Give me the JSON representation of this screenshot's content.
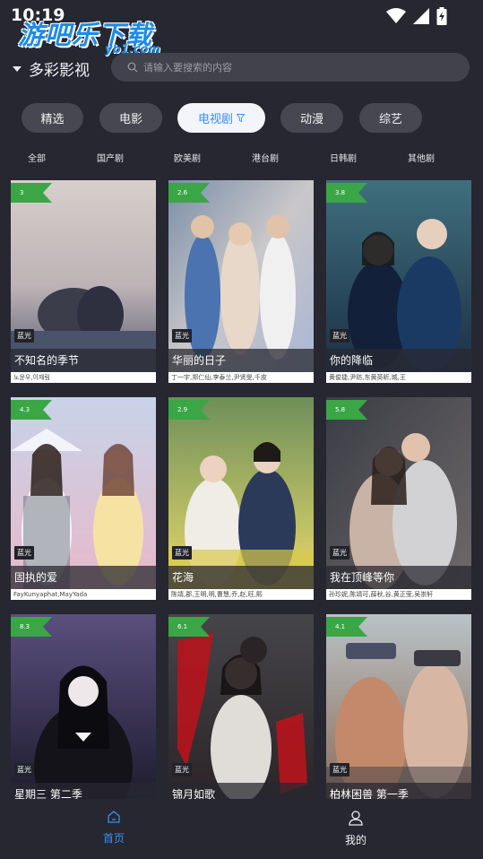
{
  "status": {
    "time": "10:19"
  },
  "watermark": {
    "text": "游吧乐下载",
    "sub": "yb1.com"
  },
  "header": {
    "site_name": "多彩影视",
    "search_placeholder": "请输入要搜索的内容"
  },
  "categories": [
    {
      "label": "精选",
      "active": false
    },
    {
      "label": "电影",
      "active": false
    },
    {
      "label": "电视剧",
      "active": true
    },
    {
      "label": "动漫",
      "active": false
    },
    {
      "label": "综艺",
      "active": false
    }
  ],
  "subfilters": [
    "全部",
    "国产剧",
    "欧美剧",
    "港台剧",
    "日韩剧",
    "其他剧"
  ],
  "cards": [
    {
      "rating": "3",
      "quality": "蓝光",
      "title": "不知名的季节",
      "cast": "노윤우,이재림"
    },
    {
      "rating": "2.6",
      "quality": "蓝光",
      "title": "华丽的日子",
      "cast": "丁一宇,郑仁仙,李泰兰,尹贤旻,千皮"
    },
    {
      "rating": "3.8",
      "quality": "蓝光",
      "title": "你的降临",
      "cast": "黄俊捷,尹昉,东黄英昕,城,王"
    },
    {
      "rating": "4.3",
      "quality": "蓝光",
      "title": "固执的爱",
      "cast": "FayKunyaphat,MayYada"
    },
    {
      "rating": "2.9",
      "quality": "蓝光",
      "title": "花海",
      "cast": "陈靖,郡,王明,明,曹慧,乔,赵,旺,熙"
    },
    {
      "rating": "5.8",
      "quality": "蓝光",
      "title": "我在顶峰等你",
      "cast": "孙珍妮,陈靖可,薛秋,谷,黄正莹,吴崇轩"
    },
    {
      "rating": "8.3",
      "quality": "蓝光",
      "title": "星期三 第二季",
      "cast": ""
    },
    {
      "rating": "6.1",
      "quality": "蓝光",
      "title": "锦月如歌",
      "cast": ""
    },
    {
      "rating": "4.1",
      "quality": "蓝光",
      "title": "柏林困兽 第一季",
      "cast": ""
    }
  ],
  "bottom_nav": [
    {
      "label": "首页",
      "icon": "home-icon",
      "active": true
    },
    {
      "label": "我的",
      "icon": "user-icon",
      "active": false
    }
  ],
  "colors": {
    "accent": "#3a8ef2",
    "rating_badge": "#3aa646",
    "background": "#262731"
  }
}
